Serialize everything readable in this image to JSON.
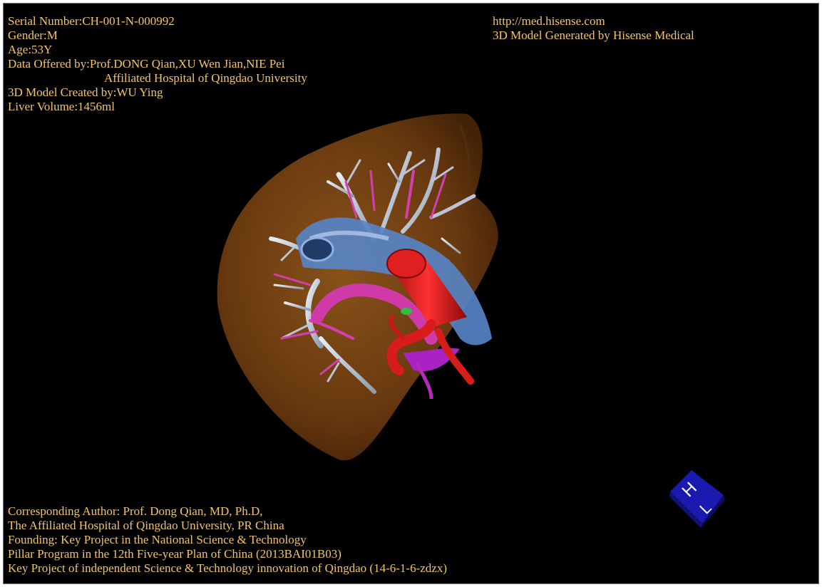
{
  "header_left": {
    "serial": "Serial Number:CH-001-N-000992",
    "gender": "Gender:M",
    "age": "Age:53Y",
    "data_offered": "Data Offered by:Prof.DONG Qian,XU Wen Jian,NIE Pei",
    "hospital": "Affiliated Hospital of Qingdao University",
    "model_created": "3D Model Created by:WU Ying",
    "liver_volume": "Liver Volume:1456ml"
  },
  "header_right": {
    "url": "http://med.hisense.com",
    "generated": "3D Model Generated by Hisense Medical"
  },
  "footer": {
    "line1": "Corresponding Author: Prof. Dong Qian, MD, Ph.D,",
    "line2": "The Affiliated Hospital of Qingdao University, PR China",
    "line3": "Founding: Key Project in the National Science & Technology",
    "line4": "Pillar Program in the 12th Five-year Plan of China (2013BAI01B03)",
    "line5": "Key Project of independent Science & Technology innovation of Qingdao (14-6-1-6-zdzx)"
  },
  "orientation_cube": {
    "labels": [
      "H",
      "L"
    ],
    "color": "#1a1ab0"
  },
  "colors": {
    "text": "#f2c56a",
    "background": "#000000",
    "liver": "#8a4a12",
    "hepatic_vein": "#b8c4d4",
    "portal_vein_pink": "#d43fb0",
    "artery_red": "#d81c1c",
    "ivc_blue": "#4f7fc4",
    "gallbladder_green": "#2fbf3a"
  }
}
